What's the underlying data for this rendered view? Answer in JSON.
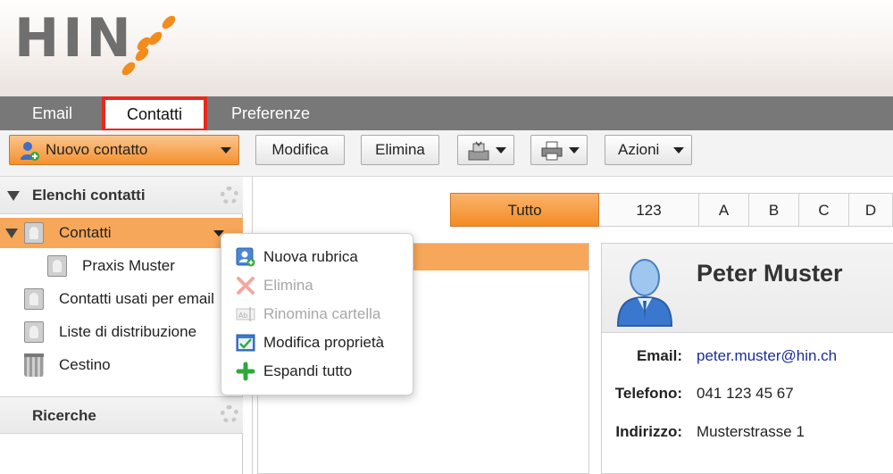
{
  "brand": {
    "logo_text": "HIN"
  },
  "tabs": [
    {
      "label": "Email"
    },
    {
      "label": "Contatti",
      "active": true
    },
    {
      "label": "Preferenze"
    }
  ],
  "toolbar": {
    "new_contact_label": "Nuovo contatto",
    "edit_label": "Modifica",
    "delete_label": "Elimina",
    "actions_label": "Azioni"
  },
  "left_panel": {
    "contact_lists_title": "Elenchi contatti",
    "items": [
      {
        "label": "Contatti",
        "selected": true
      },
      {
        "label": "Praxis Muster"
      },
      {
        "label": "Contatti usati per email"
      },
      {
        "label": "Liste di distribuzione"
      },
      {
        "label": "Cestino"
      }
    ],
    "searches_title": "Ricerche"
  },
  "alphabet_filter": {
    "items": [
      "Tutto",
      "123",
      "A",
      "B",
      "C",
      "D"
    ],
    "active": "Tutto"
  },
  "context_menu": {
    "items": [
      {
        "label": "Nuova rubrica",
        "icon": "new-addressbook-icon",
        "enabled": true
      },
      {
        "label": "Elimina",
        "icon": "red-x-icon",
        "enabled": false
      },
      {
        "label": "Rinomina cartella",
        "icon": "rename-icon",
        "enabled": false
      },
      {
        "label": "Modifica proprietà",
        "icon": "edit-properties-icon",
        "enabled": true
      },
      {
        "label": "Espandi tutto",
        "icon": "green-plus-icon",
        "enabled": true
      }
    ]
  },
  "contact": {
    "name": "Peter Muster",
    "email_label": "Email:",
    "email": "peter.muster@hin.ch",
    "phone_label": "Telefono:",
    "phone": "041 123 45 67",
    "address_label": "Indirizzo:",
    "address": "Musterstrasse 1"
  },
  "colors": {
    "accent_orange": "#f5902e",
    "selection": "#f7a75a",
    "tab_bar": "#787878",
    "highlight_red": "#e8291c",
    "link": "#1a2e9a"
  }
}
